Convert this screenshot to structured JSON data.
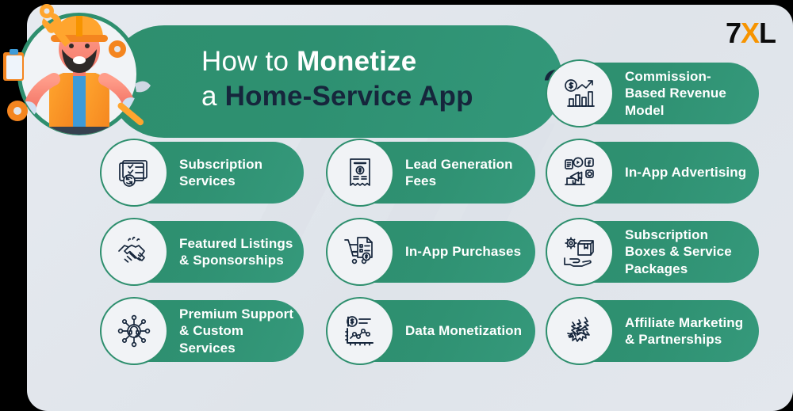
{
  "brand": {
    "logo_part1": "7",
    "logo_part2": "X",
    "logo_part3": "L",
    "accent_orange": "#f79400",
    "accent_green": "#2e9071",
    "accent_navy": "#16263c"
  },
  "header": {
    "line1_thin": "How to ",
    "line1_bold": "Monetize",
    "line2_thin": "a ",
    "line2_dark": "Home-Service App",
    "question_mark": "?"
  },
  "mascot": {
    "alt": "handyman-illustration"
  },
  "watermark": {
    "text": "7XL"
  },
  "cards": [
    {
      "id": "commission-based-revenue-model",
      "label": "Commission-Based Revenue Model",
      "icon": "growth-chart-dollar-icon",
      "col": 3,
      "row": 0
    },
    {
      "id": "subscription-services",
      "label": "Subscription Services",
      "icon": "document-refresh-icon",
      "col": 1,
      "row": 1
    },
    {
      "id": "lead-generation-fees",
      "label": "Lead Generation Fees",
      "icon": "fee-receipt-icon",
      "col": 2,
      "row": 1
    },
    {
      "id": "in-app-advertising",
      "label": "In-App Advertising",
      "icon": "megaphone-ads-icon",
      "col": 3,
      "row": 1
    },
    {
      "id": "featured-listings-sponsorships",
      "label": "Featured Listings & Sponsorships",
      "icon": "handshake-icon",
      "col": 1,
      "row": 2
    },
    {
      "id": "in-app-purchases",
      "label": "In-App Purchases",
      "icon": "shopping-cart-list-icon",
      "col": 2,
      "row": 2
    },
    {
      "id": "subscription-boxes-service-packages",
      "label": "Subscription Boxes & Service Packages",
      "icon": "hand-box-gear-icon",
      "col": 3,
      "row": 2
    },
    {
      "id": "premium-support-custom-services",
      "label": "Premium Support & Custom Services",
      "icon": "support-network-icon",
      "col": 1,
      "row": 3
    },
    {
      "id": "data-monetization",
      "label": "Data Monetization",
      "icon": "data-chart-dollar-icon",
      "col": 2,
      "row": 3
    },
    {
      "id": "affiliate-marketing-partnerships",
      "label": "Affiliate Marketing & Partnerships",
      "icon": "affiliate-network-icon",
      "col": 3,
      "row": 3
    }
  ]
}
